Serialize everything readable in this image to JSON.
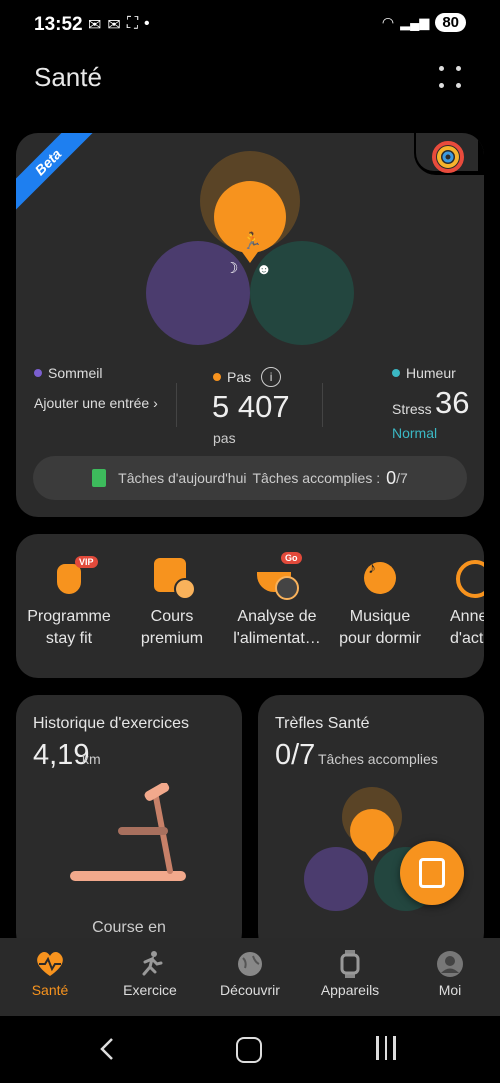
{
  "status": {
    "time": "13:52",
    "battery": "80"
  },
  "header": {
    "title": "Santé"
  },
  "summary": {
    "beta": "Beta",
    "sleep_label": "Sommeil",
    "sleep_action": "Ajouter une entrée",
    "steps_label": "Pas",
    "steps_value": "5 407",
    "steps_unit": "pas",
    "mood_label": "Humeur",
    "stress_label": "Stress",
    "stress_value": "36",
    "stress_status": "Normal",
    "tasks_today": "Tâches d'aujourd'hui",
    "tasks_done_label": "Tâches accomplies :",
    "tasks_done": "0",
    "tasks_total": "/7"
  },
  "quick": [
    {
      "line1": "Programme",
      "line2": "stay fit",
      "badge": "VIP"
    },
    {
      "line1": "Cours",
      "line2": "premium"
    },
    {
      "line1": "Analyse de",
      "line2": "l'alimentat…",
      "badge": "Go"
    },
    {
      "line1": "Musique",
      "line2": "pour dormir"
    },
    {
      "line1": "Anne",
      "line2": "d'act"
    }
  ],
  "exercise": {
    "title": "Historique d'exercices",
    "value": "4,19",
    "unit": "km",
    "caption": "Course en"
  },
  "clover": {
    "title": "Trèfles Santé",
    "value": "0/7",
    "caption": "Tâches accomplies"
  },
  "nav": [
    {
      "label": "Santé",
      "active": true
    },
    {
      "label": "Exercice"
    },
    {
      "label": "Découvrir"
    },
    {
      "label": "Appareils"
    },
    {
      "label": "Moi"
    }
  ],
  "colors": {
    "accent": "#f7931e",
    "sleep": "#7b5fcf",
    "mood": "#3bb8c4",
    "blue": "#1e7ff0"
  }
}
